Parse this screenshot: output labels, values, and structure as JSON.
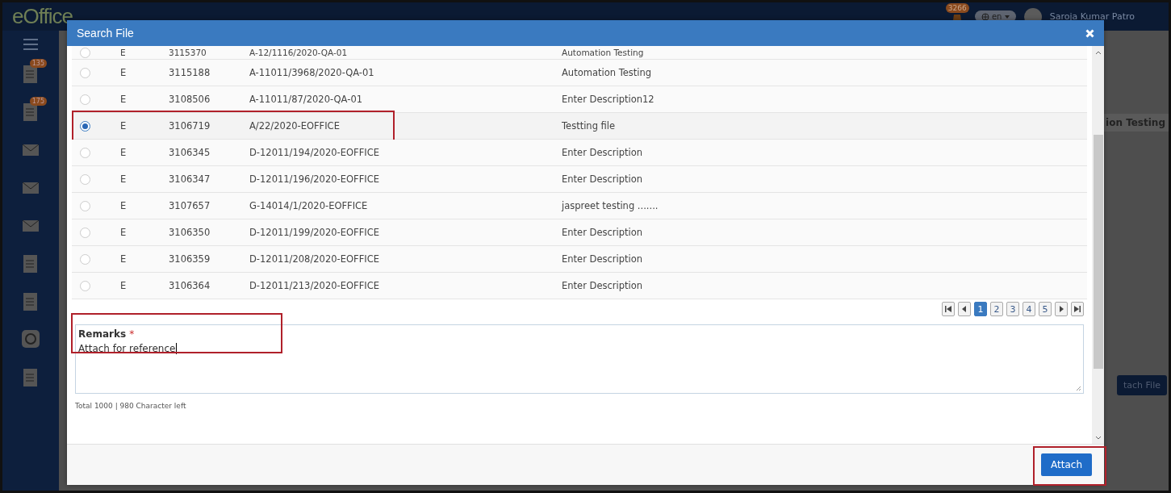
{
  "app": {
    "logo": "eOffice",
    "notification_count": "3266",
    "language": "en",
    "user_name": "Saroja Kumar Patro",
    "sidebar_badges": [
      "135",
      "175"
    ],
    "behind_texts": [
      "ion Testing",
      "tach File"
    ]
  },
  "dialog": {
    "title": "Search File",
    "rows": [
      {
        "type": "E",
        "number": "3115370",
        "file_number": "A-12/1116/2020-QA-01",
        "description": "Automation Testing",
        "selected": false,
        "highlighted": false
      },
      {
        "type": "E",
        "number": "3115188",
        "file_number": "A-11011/3968/2020-QA-01",
        "description": "Automation Testing",
        "selected": false,
        "highlighted": false
      },
      {
        "type": "E",
        "number": "3108506",
        "file_number": "A-11011/87/2020-QA-01",
        "description": "Enter Description12",
        "selected": false,
        "highlighted": false
      },
      {
        "type": "E",
        "number": "3106719",
        "file_number": "A/22/2020-EOFFICE",
        "description": "Testting file",
        "selected": true,
        "highlighted": true
      },
      {
        "type": "E",
        "number": "3106345",
        "file_number": "D-12011/194/2020-EOFFICE",
        "description": "Enter Description",
        "selected": false,
        "highlighted": false
      },
      {
        "type": "E",
        "number": "3106347",
        "file_number": "D-12011/196/2020-EOFFICE",
        "description": "Enter Description",
        "selected": false,
        "highlighted": false
      },
      {
        "type": "E",
        "number": "3107657",
        "file_number": "G-14014/1/2020-EOFFICE",
        "description": "jaspreet testing .......",
        "selected": false,
        "highlighted": false
      },
      {
        "type": "E",
        "number": "3106350",
        "file_number": "D-12011/199/2020-EOFFICE",
        "description": "Enter Description",
        "selected": false,
        "highlighted": false
      },
      {
        "type": "E",
        "number": "3106359",
        "file_number": "D-12011/208/2020-EOFFICE",
        "description": "Enter Description",
        "selected": false,
        "highlighted": false
      },
      {
        "type": "E",
        "number": "3106364",
        "file_number": "D-12011/213/2020-EOFFICE",
        "description": "Enter Description",
        "selected": false,
        "highlighted": false
      }
    ],
    "pages": [
      {
        "label": "1",
        "selected": true
      },
      {
        "label": "2",
        "selected": false
      },
      {
        "label": "3",
        "selected": false
      },
      {
        "label": "4",
        "selected": false
      },
      {
        "label": "5",
        "selected": false
      }
    ],
    "remarks": {
      "label": "Remarks",
      "required_mark": "*",
      "value": "Attach for reference",
      "counter": "Total 1000 | 980 Character left",
      "highlighted": true
    },
    "attach_button": {
      "label": "Attach",
      "highlighted": true
    }
  }
}
